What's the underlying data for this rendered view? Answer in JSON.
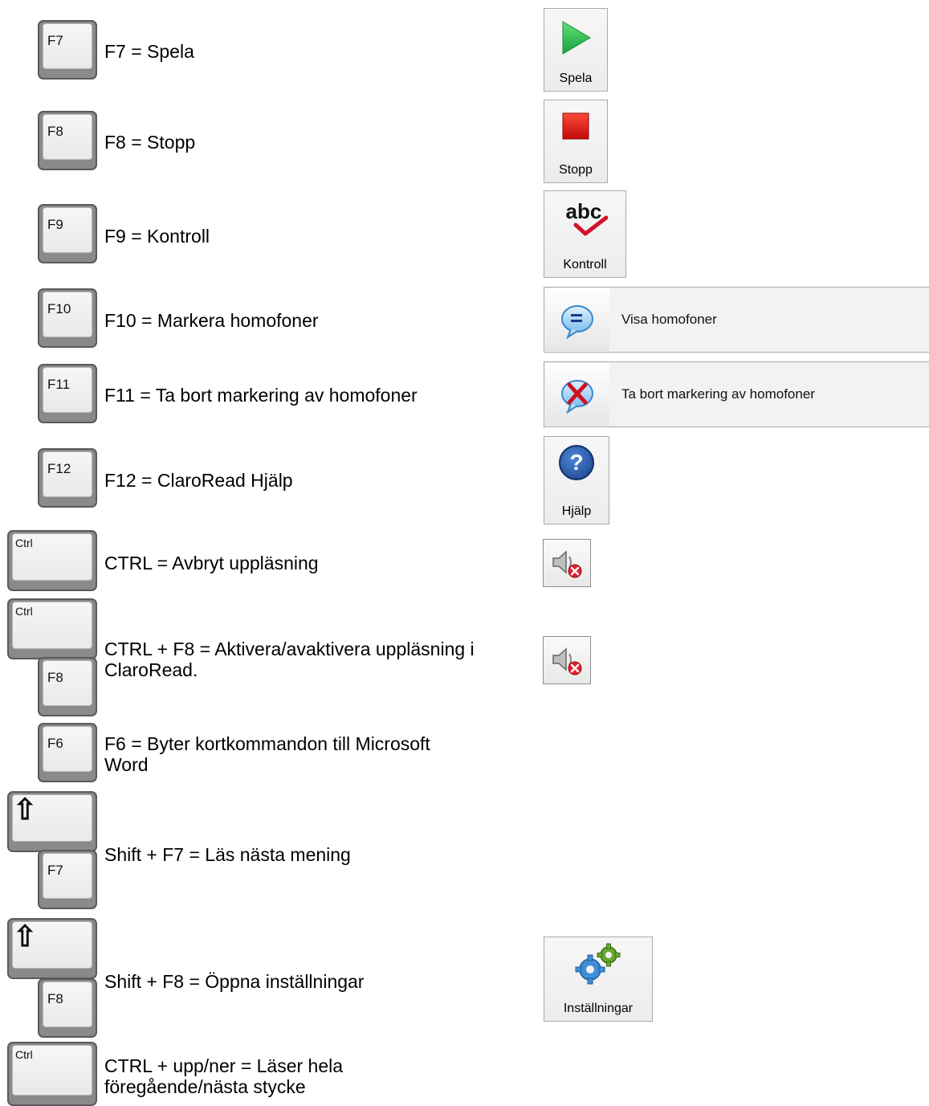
{
  "rows": [
    {
      "keys": [
        "F7"
      ],
      "desc": "F7 = Spela"
    },
    {
      "keys": [
        "F8"
      ],
      "desc": "F8 = Stopp"
    },
    {
      "keys": [
        "F9"
      ],
      "desc": "F9 = Kontroll"
    },
    {
      "keys": [
        "F10"
      ],
      "desc": "F10 = Markera homofoner"
    },
    {
      "keys": [
        "F11"
      ],
      "desc": "F11 = Ta bort markering av homofoner"
    },
    {
      "keys": [
        "F12"
      ],
      "desc": "F12 = ClaroRead Hjälp"
    },
    {
      "keys": [
        "Ctrl"
      ],
      "desc": "CTRL = Avbryt uppläsning"
    },
    {
      "keys": [
        "Ctrl",
        "F8"
      ],
      "desc_lines": [
        "CTRL + F8 = Aktivera/avaktivera uppläsning i",
        "ClaroRead."
      ]
    },
    {
      "keys": [
        "F6"
      ],
      "desc_lines": [
        "F6 = Byter kortkommandon till Microsoft",
        "Word"
      ]
    },
    {
      "keys": [
        "⇧",
        "F7"
      ],
      "desc": "Shift + F7 = Läs nästa mening"
    },
    {
      "keys": [
        "⇧",
        "F8"
      ],
      "desc": "Shift + F8 = Öppna inställningar"
    },
    {
      "keys": [
        "Ctrl"
      ],
      "desc_lines": [
        "CTRL + upp/ner = Läser hela",
        "föregående/nästa stycke"
      ]
    }
  ],
  "toolbar": {
    "play": {
      "label": "Spela",
      "icon": "play-icon",
      "color": "#22b14c"
    },
    "stop": {
      "label": "Stopp",
      "icon": "stop-icon",
      "color": "#e01010"
    },
    "check": {
      "label": "Kontroll",
      "icon_text": "abc",
      "icon": "spellcheck-icon"
    },
    "show_homophones": {
      "label": "Visa homofoner",
      "icon": "homophone-bubble-icon"
    },
    "remove_homophones": {
      "label": "Ta bort markering av homofoner",
      "icon": "remove-homophone-icon"
    },
    "help": {
      "label": "Hjälp",
      "icon_text": "?",
      "icon": "help-icon",
      "color": "#1c4f9c"
    },
    "mute1": {
      "icon": "speaker-mute-icon"
    },
    "mute2": {
      "icon": "speaker-mute-icon"
    },
    "settings": {
      "label": "Inställningar",
      "icon": "gears-icon"
    }
  }
}
